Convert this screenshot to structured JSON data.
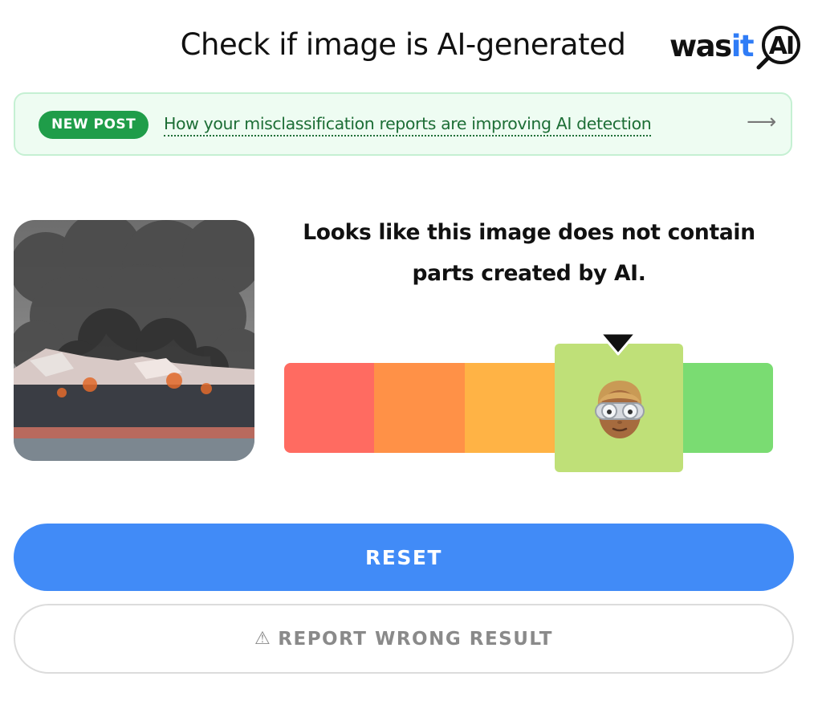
{
  "header": {
    "title": "Check if image is AI-generated"
  },
  "logo": {
    "word_prefix": "was",
    "word_accent": "it",
    "badge_text": "AI"
  },
  "news": {
    "badge": "NEW POST",
    "link_text": "How your misclassification reports are improving AI detection",
    "arrow_icon": "arrow-right-icon"
  },
  "result": {
    "verdict": "Looks like this image does not contain parts created by AI.",
    "meter": {
      "segment_colors": [
        "#ff6b61",
        "#ff9147",
        "#ffb345",
        "#bfe078",
        "#7adc72"
      ],
      "active_segment": 4,
      "active_icon": "human-face-goggles-icon"
    }
  },
  "buttons": {
    "reset": "RESET",
    "report": "REPORT WRONG RESULT",
    "report_icon": "warning-triangle-icon"
  },
  "colors": {
    "accent_blue": "#418bf7",
    "news_green": "#1f9d49"
  }
}
